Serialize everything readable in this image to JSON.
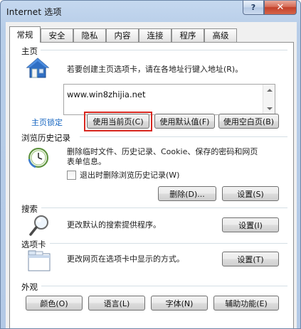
{
  "window": {
    "title": "Internet 选项",
    "help_label": "?",
    "close_label": "✕"
  },
  "tabs": [
    "常规",
    "安全",
    "隐私",
    "内容",
    "连接",
    "程序",
    "高级"
  ],
  "home": {
    "section_title": "主页",
    "description": "若要创建主页选项卡，请在各地址行键入地址(R)。",
    "url": "www.win8zhijia.net",
    "lock_label": "主页锁定",
    "use_current": "使用当前页(C)",
    "use_default": "使用默认值(F)",
    "use_blank": "使用空白页(B)"
  },
  "history": {
    "section_title": "浏览历史记录",
    "description_line1": "删除临时文件、历史记录、Cookie、保存的密码和网页",
    "description_line2": "表单信息。",
    "checkbox_label": "退出时删除浏览历史记录(W)",
    "delete_button": "删除(D)...",
    "settings_button": "设置(S)"
  },
  "search": {
    "section_title": "搜索",
    "description": "更改默认的搜索提供程序。",
    "settings_button": "设置(I)"
  },
  "tabs_section": {
    "section_title": "选项卡",
    "description": "更改网页在选项卡中显示的方式。",
    "settings_button": "设置(T)"
  },
  "appearance": {
    "section_title": "外观",
    "colors_button": "颜色(O)",
    "languages_button": "语言(L)",
    "fonts_button": "字体(N)",
    "accessibility_button": "辅助功能(E)"
  },
  "colors": {
    "highlight": "#d8271f",
    "link": "#1565c0",
    "title_bar": "#c5d8ef"
  }
}
